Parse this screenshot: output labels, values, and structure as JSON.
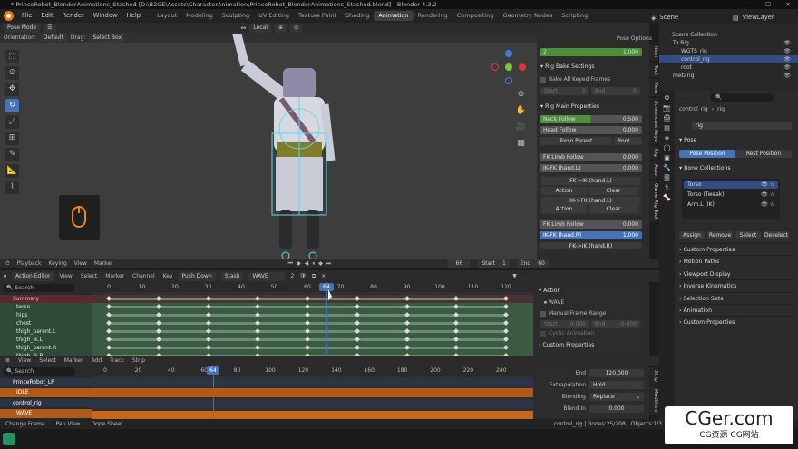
{
  "window": {
    "title": "* PrinceRobot_BlenderAnimations_Stashed [D:\\B2GE\\Assets\\CharacterAnimation\\PrinceRobot_BlenderAnimations_Stashed.blend] - Blender 4.3.2",
    "min": "—",
    "max": "☐",
    "close": "✕"
  },
  "menu": {
    "items": [
      "File",
      "Edit",
      "Render",
      "Window",
      "Help"
    ]
  },
  "workspaces": [
    {
      "label": "Layout",
      "active": false
    },
    {
      "label": "Modeling",
      "active": false
    },
    {
      "label": "Sculpting",
      "active": false
    },
    {
      "label": "UV Editing",
      "active": false
    },
    {
      "label": "Texture Paint",
      "active": false
    },
    {
      "label": "Shading",
      "active": false
    },
    {
      "label": "Animation",
      "active": true
    },
    {
      "label": "Rendering",
      "active": false
    },
    {
      "label": "Compositing",
      "active": false
    },
    {
      "label": "Geometry Nodes",
      "active": false
    },
    {
      "label": "Scripting",
      "active": false
    }
  ],
  "scene": {
    "name": "Scene",
    "view_layer": "ViewLayer"
  },
  "viewport": {
    "mode": "Pose Mode",
    "orientation_label": "Orientation:",
    "orientation": "Default",
    "drag_label": "Drag:",
    "drag": "Select Box",
    "transform_space": "Local",
    "playback_controls": [
      "Playback",
      "Keying",
      "View",
      "Marker"
    ]
  },
  "rig_panel": {
    "pose_options": "Pose Options",
    "top_field": {
      "label": "2",
      "value": "1.000"
    },
    "bake_header": "Rig Bake Settings",
    "bake_all": "Bake All Keyed Frames",
    "start_label": "Start",
    "start_value": "0",
    "end_label": "End",
    "end_value": "0",
    "main_header": "Rig Main Properties",
    "neck_follow": {
      "label": "Neck Follow",
      "value": "0.500",
      "fill": 0.5
    },
    "head_follow": {
      "label": "Head Follow",
      "value": "0.000",
      "fill": 0
    },
    "torso_parent": "Torso Parent",
    "torso_parent_value": "Root",
    "fk_limb_follow_l": {
      "label": "FK Limb Follow",
      "value": "0.000"
    },
    "ik_fk_l": {
      "label": "IK-FK (hand.L)",
      "value": "0.000"
    },
    "fk_to_ik_l": "FK->IK (hand.L)",
    "ik_to_fk_l": "IK->FK (hand.L)",
    "action": "Action",
    "clear": "Clear",
    "fk_limb_follow_r": {
      "label": "FK Limb Follow",
      "value": "0.000"
    },
    "ik_fk_r": {
      "label": "IK-FK (hand.R)",
      "value": "1.000"
    },
    "fk_to_ik_r": "FK->IK (hand.R)"
  },
  "side_tabs": [
    "Item",
    "Tool",
    "View",
    "Screencast Keys",
    "Rig",
    "Auto",
    "Game Rig Tool"
  ],
  "outliner": {
    "collection": "Scene Collection",
    "rows": [
      {
        "label": "To Rig",
        "indent": 1
      },
      {
        "label": "WGTS_rig",
        "indent": 2
      },
      {
        "label": "control_rig",
        "indent": 2,
        "selected": true
      },
      {
        "label": "root",
        "indent": 2
      },
      {
        "label": "metarig",
        "indent": 1
      }
    ]
  },
  "properties": {
    "object": "control_rig",
    "armature": "rig",
    "data_name": "rig",
    "pose_header": "Pose",
    "pose_position": "Pose Position",
    "rest_position": "Rest Position",
    "bone_collections_header": "Bone Collections",
    "bone_collections": [
      {
        "name": "Torso",
        "selected": true
      },
      {
        "name": "Torso (Tweak)",
        "selected": false
      },
      {
        "name": "Arm.L (IK)",
        "selected": false
      }
    ],
    "buttons": [
      "Assign",
      "Remove",
      "Select",
      "Deselect"
    ],
    "subpanels": [
      "Custom Properties",
      "Motion Paths",
      "Viewport Display",
      "Inverse Kinematics",
      "Selection Sets",
      "Animation",
      "Custom Properties"
    ]
  },
  "timeline": {
    "current_frame": "66",
    "start_label": "Start",
    "start": "1",
    "end_label": "End",
    "end": "60"
  },
  "action_editor": {
    "mode": "Action Editor",
    "menus": [
      "View",
      "Select",
      "Marker",
      "Channel",
      "Key"
    ],
    "push_down": "Push Down",
    "stash": "Stash",
    "action_name": "WAVE",
    "users": "2",
    "search_placeholder": "Search",
    "ruler": [
      "0",
      "10",
      "20",
      "30",
      "40",
      "50",
      "60",
      "70",
      "80",
      "90",
      "100",
      "110",
      "120"
    ],
    "playhead": "64",
    "channels": [
      "Summary",
      "torso",
      "hips",
      "chest",
      "thigh_parent.L",
      "thigh_ik.L",
      "thigh_parent.R",
      "thigh_ik.R"
    ],
    "keyframes": [
      0,
      15,
      30,
      45,
      60,
      75,
      90,
      105,
      120
    ],
    "panel": {
      "action_header": "Action",
      "action_name": "WAVE",
      "manual_range": "Manual Frame Range",
      "start_label": "Start",
      "start": "0.000",
      "end_label": "End",
      "end": "0.000",
      "cyclic": "Cyclic Animation",
      "custom_props": "Custom Properties"
    }
  },
  "nla": {
    "menus": [
      "View",
      "Select",
      "Marker",
      "Add",
      "Track",
      "Strip"
    ],
    "search_placeholder": "Search",
    "ruler": [
      "0",
      "20",
      "40",
      "60",
      "80",
      "100",
      "120",
      "140",
      "160",
      "180",
      "200",
      "220",
      "240"
    ],
    "playhead": "64",
    "tracks": [
      {
        "label": "PrinceRobot_LP",
        "type": "object"
      },
      {
        "label": "IDLE",
        "type": "strip"
      },
      {
        "label": "control_rig",
        "type": "object"
      },
      {
        "label": "WAVE",
        "type": "strip"
      }
    ],
    "strip_panel": {
      "end_label": "End",
      "end": "120.000",
      "extrapolation_label": "Extrapolation",
      "extrapolation": "Hold",
      "blending_label": "Blending",
      "blending": "Replace",
      "blend_in_label": "Blend In",
      "blend_in": "0.000"
    },
    "strip_tabs": [
      "Strip",
      "Modifiers"
    ]
  },
  "statusbar": {
    "items": [
      "Change Frame",
      "Pan View",
      "Dope Sheet"
    ],
    "right": "control_rig | Bones:25/208 | Objects:1/3"
  },
  "watermark": {
    "title": "CGer.com",
    "subtitle": "CG资源 CG网站"
  },
  "colors": {
    "accent": "#4772b3",
    "green": "#4d8f3a",
    "summary": "#5a2a30",
    "channel": "#3b5a42",
    "strip": "#c6661f"
  }
}
